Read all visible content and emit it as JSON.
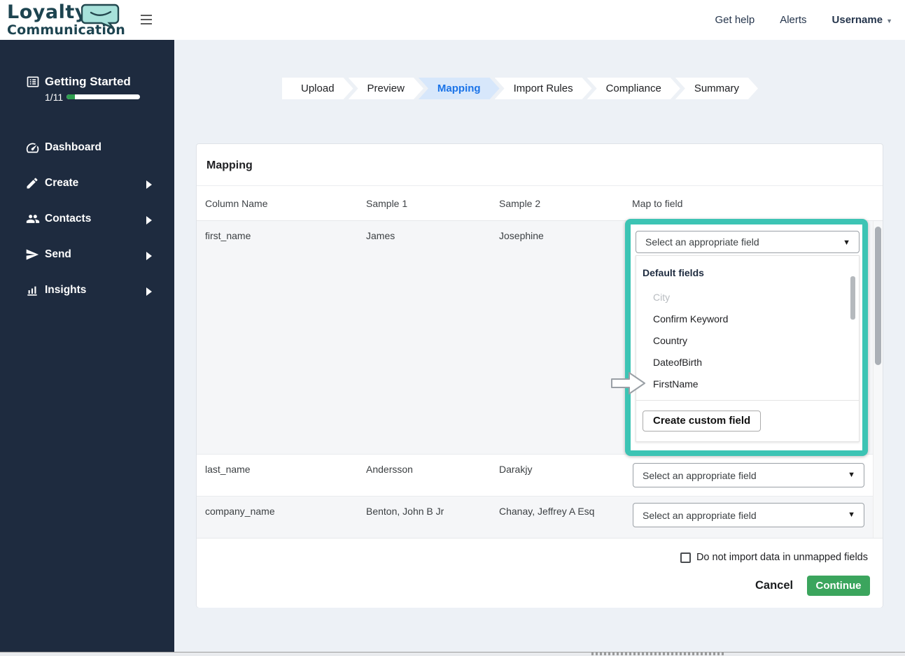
{
  "app": {
    "logo_line1": "Loyalty",
    "logo_line2": "Communication",
    "nav": {
      "get_help": "Get help",
      "alerts": "Alerts",
      "username": "Username"
    }
  },
  "sidebar": {
    "getting_started": {
      "label": "Getting Started",
      "progress_text": "1/11",
      "progress_percent": 9
    },
    "items": [
      {
        "label": "Dashboard",
        "icon": "gauge",
        "has_submenu": false
      },
      {
        "label": "Create",
        "icon": "pencil",
        "has_submenu": true
      },
      {
        "label": "Contacts",
        "icon": "people",
        "has_submenu": true
      },
      {
        "label": "Send",
        "icon": "paper-plane",
        "has_submenu": true
      },
      {
        "label": "Insights",
        "icon": "bar-chart",
        "has_submenu": true
      }
    ]
  },
  "stepper": {
    "active_step": "Mapping",
    "steps": [
      {
        "label": "Upload"
      },
      {
        "label": "Preview"
      },
      {
        "label": "Mapping"
      },
      {
        "label": "Import Rules"
      },
      {
        "label": "Compliance"
      },
      {
        "label": "Summary"
      }
    ]
  },
  "mapping_card": {
    "title": "Mapping",
    "columns": [
      "Column Name",
      "Sample 1",
      "Sample 2",
      "Map to field"
    ],
    "select_placeholder": "Select an appropriate field",
    "rows": [
      {
        "column_name": "first_name",
        "sample1": "James",
        "sample2": "Josephine"
      },
      {
        "column_name": "last_name",
        "sample1": "Andersson",
        "sample2": "Darakjy"
      },
      {
        "column_name": "company_name",
        "sample1": "Benton, John B Jr",
        "sample2": "Chanay, Jeffrey A Esq"
      }
    ],
    "dropdown": {
      "group_label": "Default fields",
      "options": [
        {
          "label": "City",
          "disabled": true
        },
        {
          "label": "Confirm Keyword",
          "disabled": false
        },
        {
          "label": "Country",
          "disabled": false
        },
        {
          "label": "DateofBirth",
          "disabled": false
        },
        {
          "label": "FirstName",
          "disabled": false
        }
      ],
      "create_custom_button": "Create custom field"
    },
    "footer": {
      "checkbox_label": "Do not import data in unmapped fields",
      "checkbox_checked": false,
      "cancel_label": "Cancel",
      "continue_label": "Continue"
    }
  },
  "colors": {
    "sidebar_bg": "#1e2b3f",
    "highlight_teal": "#3cc4b4",
    "active_step_blue": "#1a73e8",
    "active_step_bg": "#d7e7fb",
    "continue_green": "#3ba55d",
    "progress_green": "#2f9e4f",
    "logo_teal_dark": "#1d4450",
    "logo_bubble_fill": "#a7e1da"
  }
}
